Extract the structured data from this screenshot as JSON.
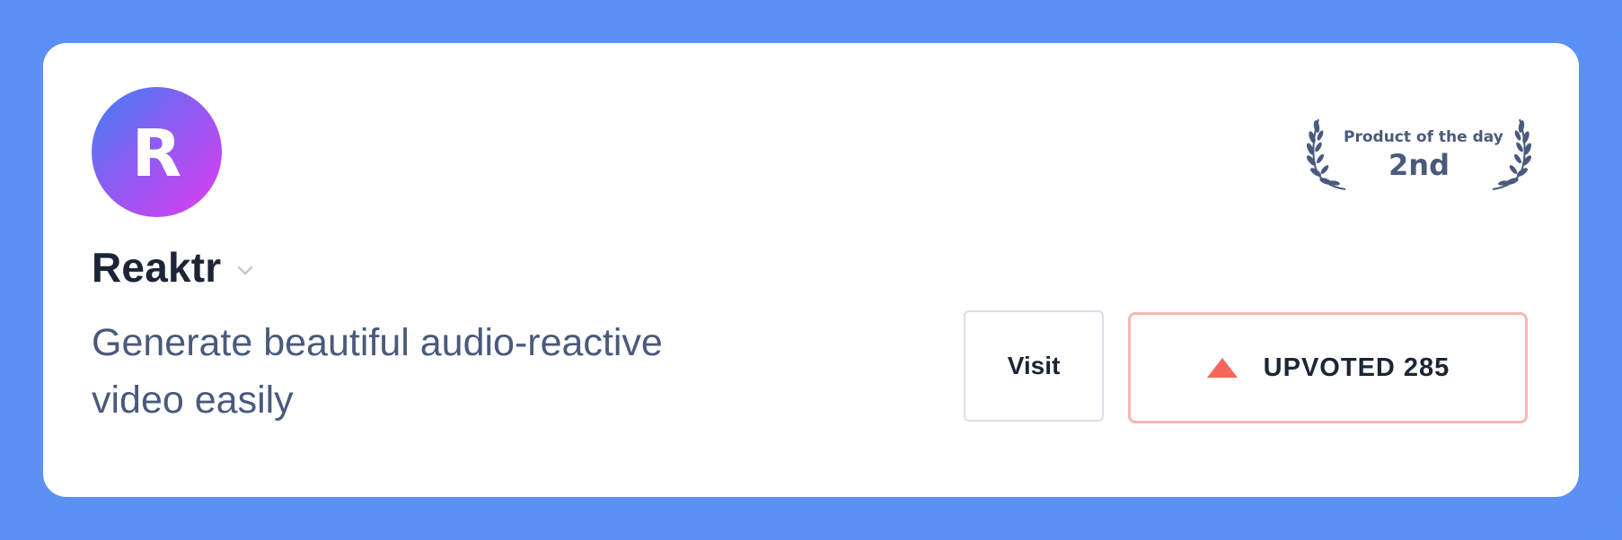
{
  "product": {
    "logo_letter": "R",
    "name": "Reaktr",
    "tagline": "Generate beautiful audio-reactive video easily"
  },
  "award": {
    "label": "Product of the day",
    "rank": "2nd"
  },
  "actions": {
    "visit_label": "Visit",
    "upvote_label": "UPVOTED 285"
  },
  "colors": {
    "background": "#5b91f5",
    "card": "#ffffff",
    "text_primary": "#1c2536",
    "text_secondary": "#4a5a7d",
    "upvote_accent": "#f4665a",
    "upvote_border": "#f5b8b3"
  },
  "icons": {
    "expand": "chevron-down-icon",
    "upvote": "triangle-up-icon",
    "award": "laurel-wreath-icon"
  }
}
